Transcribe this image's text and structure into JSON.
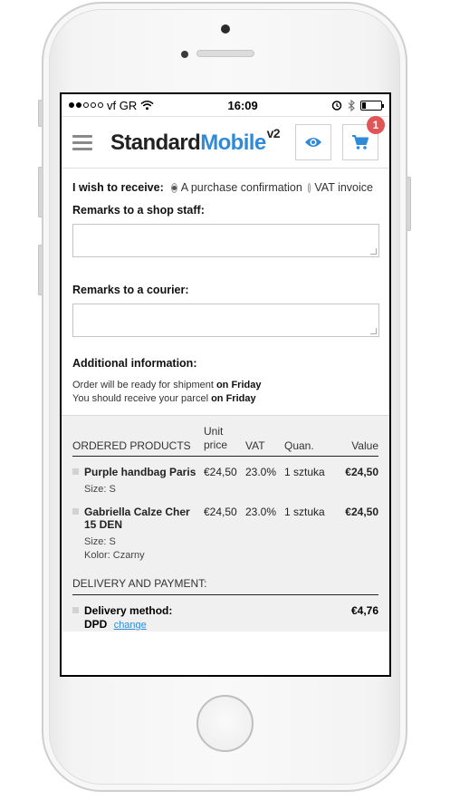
{
  "status_bar": {
    "carrier": "vf GR",
    "time": "16:09",
    "signal_bars_filled": 2,
    "battery_level": 0.2
  },
  "header": {
    "logo_part1": "Standard",
    "logo_part2": "Mobile",
    "logo_sup": "v2",
    "cart_count": "1",
    "brand_color": "#2f8bd8",
    "badge_color": "#e05656"
  },
  "form": {
    "receive_label": "I wish to receive:",
    "receive_options": [
      {
        "label": "A purchase confirmation",
        "selected": true
      },
      {
        "label": "VAT invoice",
        "selected": false
      }
    ],
    "remarks_shop_label": "Remarks to a shop staff:",
    "remarks_shop_value": "",
    "remarks_courier_label": "Remarks to a courier:",
    "remarks_courier_value": "",
    "additional_label": "Additional information:",
    "info_line1_text": "Order will be ready for shipment ",
    "info_line1_bold": "on Friday",
    "info_line2_text": "You should receive your parcel ",
    "info_line2_bold": "on Friday"
  },
  "order": {
    "columns": {
      "products": "ORDERED PRODUCTS",
      "unit_price": "Unit price",
      "vat": "VAT",
      "quantity": "Quan.",
      "value": "Value"
    },
    "products": [
      {
        "name": "Purple handbag Paris",
        "attrs": [
          "Size: S"
        ],
        "unit_price": "€24,50",
        "vat": "23.0%",
        "quantity": "1 sztuka",
        "value": "€24,50"
      },
      {
        "name": "Gabriella Calze Cher 15 DEN",
        "attrs": [
          "Size: S",
          "Kolor: Czarny"
        ],
        "unit_price": "€24,50",
        "vat": "23.0%",
        "quantity": "1 sztuka",
        "value": "€24,50"
      }
    ],
    "delivery_heading": "DELIVERY AND PAYMENT:",
    "delivery_method_label": "Delivery method:",
    "delivery_method_value": "DPD",
    "change_link": "change",
    "delivery_price": "€4,76"
  }
}
